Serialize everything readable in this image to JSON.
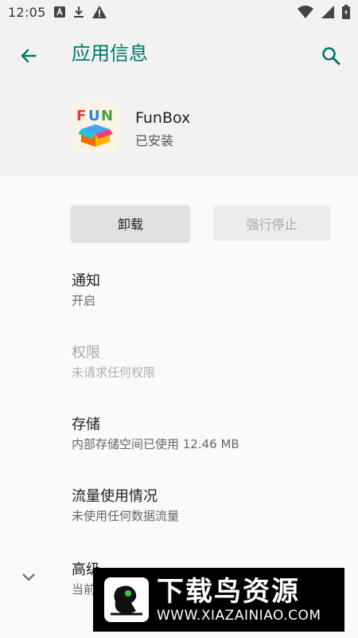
{
  "status_bar": {
    "time": "12:05",
    "left_icons": [
      "a-badge-icon",
      "download-icon",
      "warning-icon"
    ],
    "right_icons": [
      "wifi-icon",
      "signal-icon",
      "battery-icon"
    ]
  },
  "header": {
    "title": "应用信息"
  },
  "app": {
    "name": "FunBox",
    "status": "已安装",
    "icon_text": "FUN"
  },
  "buttons": {
    "uninstall": "卸载",
    "force_stop": "强行停止"
  },
  "settings": [
    {
      "title": "通知",
      "summary": "开启",
      "enabled": true
    },
    {
      "title": "权限",
      "summary": "未请求任何权限",
      "enabled": false
    },
    {
      "title": "存储",
      "summary": "内部存储空间已使用 12.46 MB",
      "enabled": true
    },
    {
      "title": "流量使用情况",
      "summary": "未使用任何数据流量",
      "enabled": true
    },
    {
      "title": "高级",
      "summary": "当前",
      "enabled": true
    }
  ],
  "watermark": {
    "title": "下载鸟资源",
    "url": "WWW.XIAZAINIAO.COM"
  },
  "colors": {
    "accent": "#00796b",
    "header_bg": "#f2f2f2",
    "body_bg": "#fafafa"
  }
}
